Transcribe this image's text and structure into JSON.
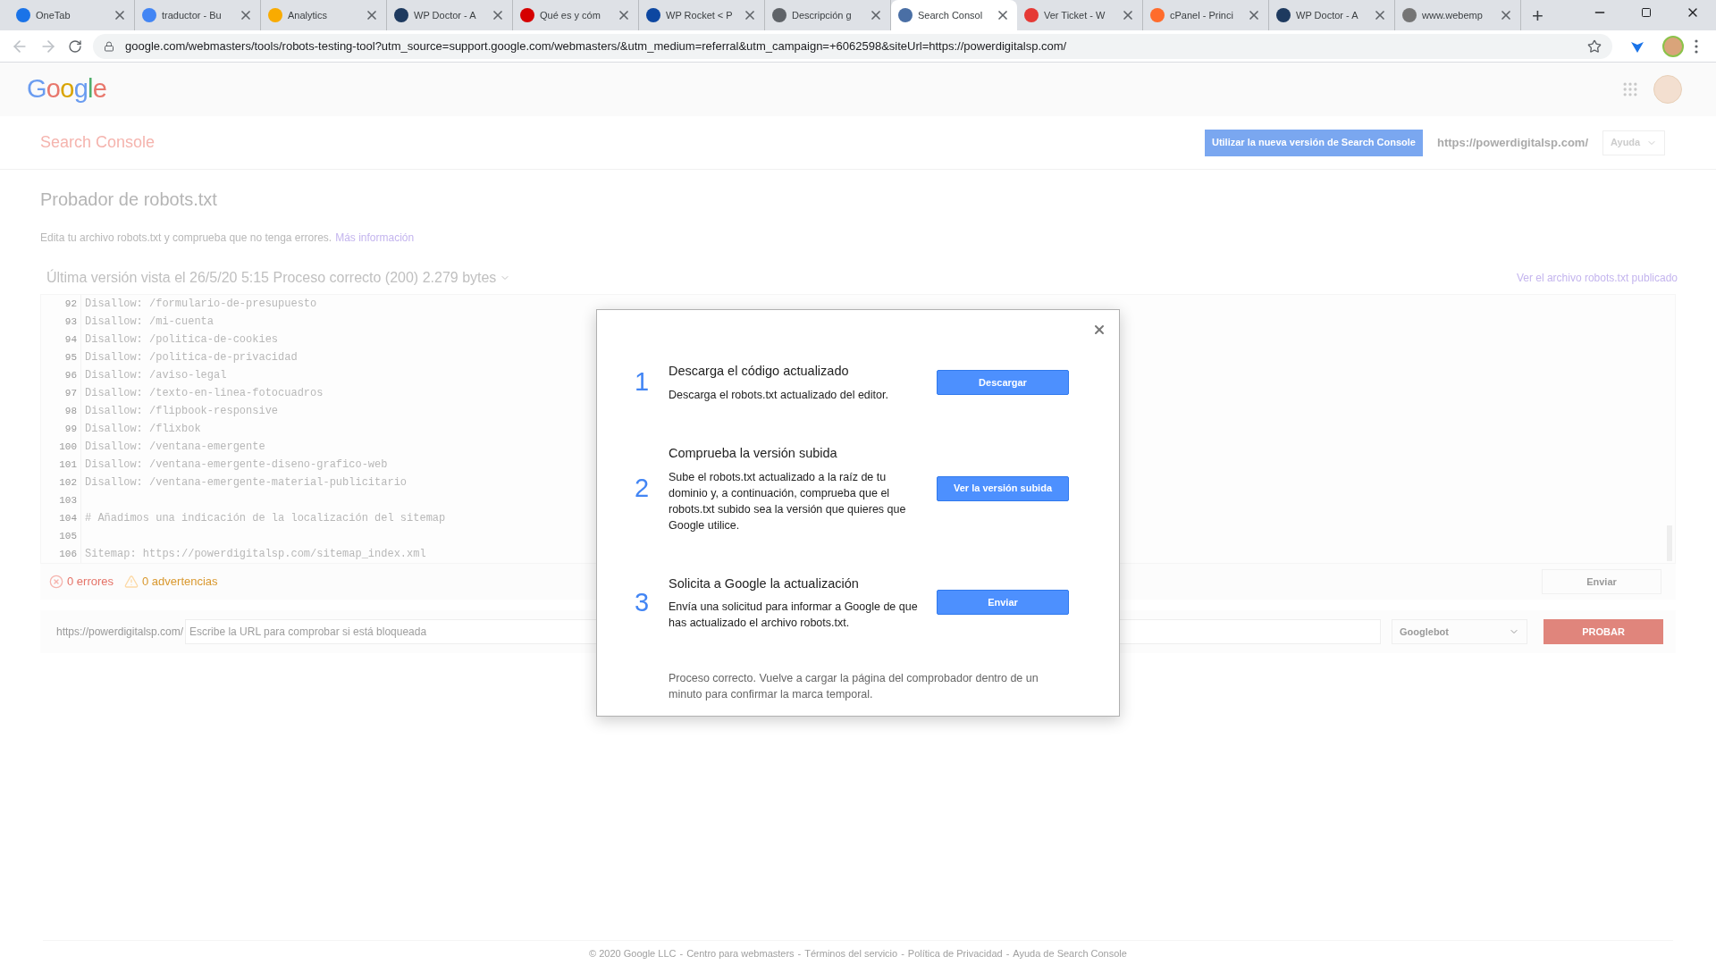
{
  "browser": {
    "tabs": [
      {
        "title": "OneTab",
        "selected": false,
        "color": "#1a73e8"
      },
      {
        "title": "traductor - Bu",
        "selected": false,
        "color": "#4285f4"
      },
      {
        "title": "Analytics",
        "selected": false,
        "color": "#f9ab00"
      },
      {
        "title": "WP Doctor - A",
        "selected": false,
        "color": "#1e3a5f"
      },
      {
        "title": "Qué es y cóm",
        "selected": false,
        "color": "#d50000"
      },
      {
        "title": "WP Rocket < P",
        "selected": false,
        "color": "#0d47a1"
      },
      {
        "title": "Descripción g",
        "selected": false,
        "color": "#5f6368"
      },
      {
        "title": "Search Consol",
        "selected": true,
        "color": "#4a6fa5"
      },
      {
        "title": "Ver Ticket - W",
        "selected": false,
        "color": "#e53935"
      },
      {
        "title": "cPanel - Princi",
        "selected": false,
        "color": "#ff6c2c"
      },
      {
        "title": "WP Doctor - A",
        "selected": false,
        "color": "#1e3a5f"
      },
      {
        "title": "www.webemp",
        "selected": false,
        "color": "#757575"
      }
    ],
    "new_tab": "+",
    "url": "google.com/webmasters/tools/robots-testing-tool?utm_source=support.google.com/webmasters/&utm_medium=referral&utm_campaign=+6062598&siteUrl=https://powerdigitalsp.com/"
  },
  "header": {
    "logo": "Google"
  },
  "console_bar": {
    "title": "Search Console",
    "new_version_button": "Utilizar la nueva versión de Search Console",
    "property": "https://powerdigitalsp.com/",
    "help": "Ayuda"
  },
  "page": {
    "title": "Probador de robots.txt",
    "description": "Edita tu archivo robots.txt y comprueba que no tenga errores.",
    "more_link": "Más información",
    "version": "Última versión vista el 26/5/20 5:15 Proceso correcto (200) 2.279 bytes",
    "published_link": "Ver el archivo robots.txt publicado"
  },
  "editor": {
    "lines": [
      {
        "number": "92",
        "text": "Disallow: /formulario-de-presupuesto"
      },
      {
        "number": "93",
        "text": "Disallow: /mi-cuenta"
      },
      {
        "number": "94",
        "text": "Disallow: /politica-de-cookies"
      },
      {
        "number": "95",
        "text": "Disallow: /politica-de-privacidad"
      },
      {
        "number": "96",
        "text": "Disallow: /aviso-legal"
      },
      {
        "number": "97",
        "text": "Disallow: /texto-en-linea-fotocuadros"
      },
      {
        "number": "98",
        "text": "Disallow: /flipbook-responsive"
      },
      {
        "number": "99",
        "text": "Disallow: /flixbok"
      },
      {
        "number": "100",
        "text": "Disallow: /ventana-emergente"
      },
      {
        "number": "101",
        "text": "Disallow: /ventana-emergente-diseno-grafico-web"
      },
      {
        "number": "102",
        "text": "Disallow: /ventana-emergente-material-publicitario"
      },
      {
        "number": "103"
      },
      {
        "number": "104",
        "text": "# Añadimos una indicación de la localización del sitemap"
      },
      {
        "number": "105"
      },
      {
        "number": "106",
        "text": "Sitemap: https://powerdigitalsp.com/sitemap_index.xml"
      }
    ],
    "errors": "0 errores",
    "warnings": "0 advertencias",
    "submit": "Enviar"
  },
  "test": {
    "prefix": "https://powerdigitalsp.com/",
    "placeholder": "Escribe la URL para comprobar si está bloqueada",
    "agent": "Googlebot",
    "button": "PROBAR"
  },
  "footer": {
    "separator": "-",
    "links": [
      "© 2020 Google LLC",
      "Centro para webmasters",
      "Términos del servicio",
      "Política de Privacidad",
      "Ayuda de Search Console"
    ]
  },
  "dialog": {
    "steps": [
      {
        "number": "1",
        "title": "Descarga el código actualizado",
        "text": "Descarga el robots.txt actualizado del editor.",
        "button": "Descargar"
      },
      {
        "number": "2",
        "title": "Comprueba la versión subida",
        "text": "Sube el robots.txt actualizado a la raíz de tu dominio y, a continuación, comprueba que el robots.txt subido sea la versión que quieres que Google utilice.",
        "button": "Ver la versión subida"
      },
      {
        "number": "3",
        "title": "Solicita a Google la actualización",
        "text": "Envía una solicitud para informar a Google de que has actualizado el archivo robots.txt.",
        "button": "Enviar"
      }
    ],
    "note": "Proceso correcto. Vuelve a cargar la página del comprobador dentro de un minuto para confirmar la marca temporal."
  }
}
